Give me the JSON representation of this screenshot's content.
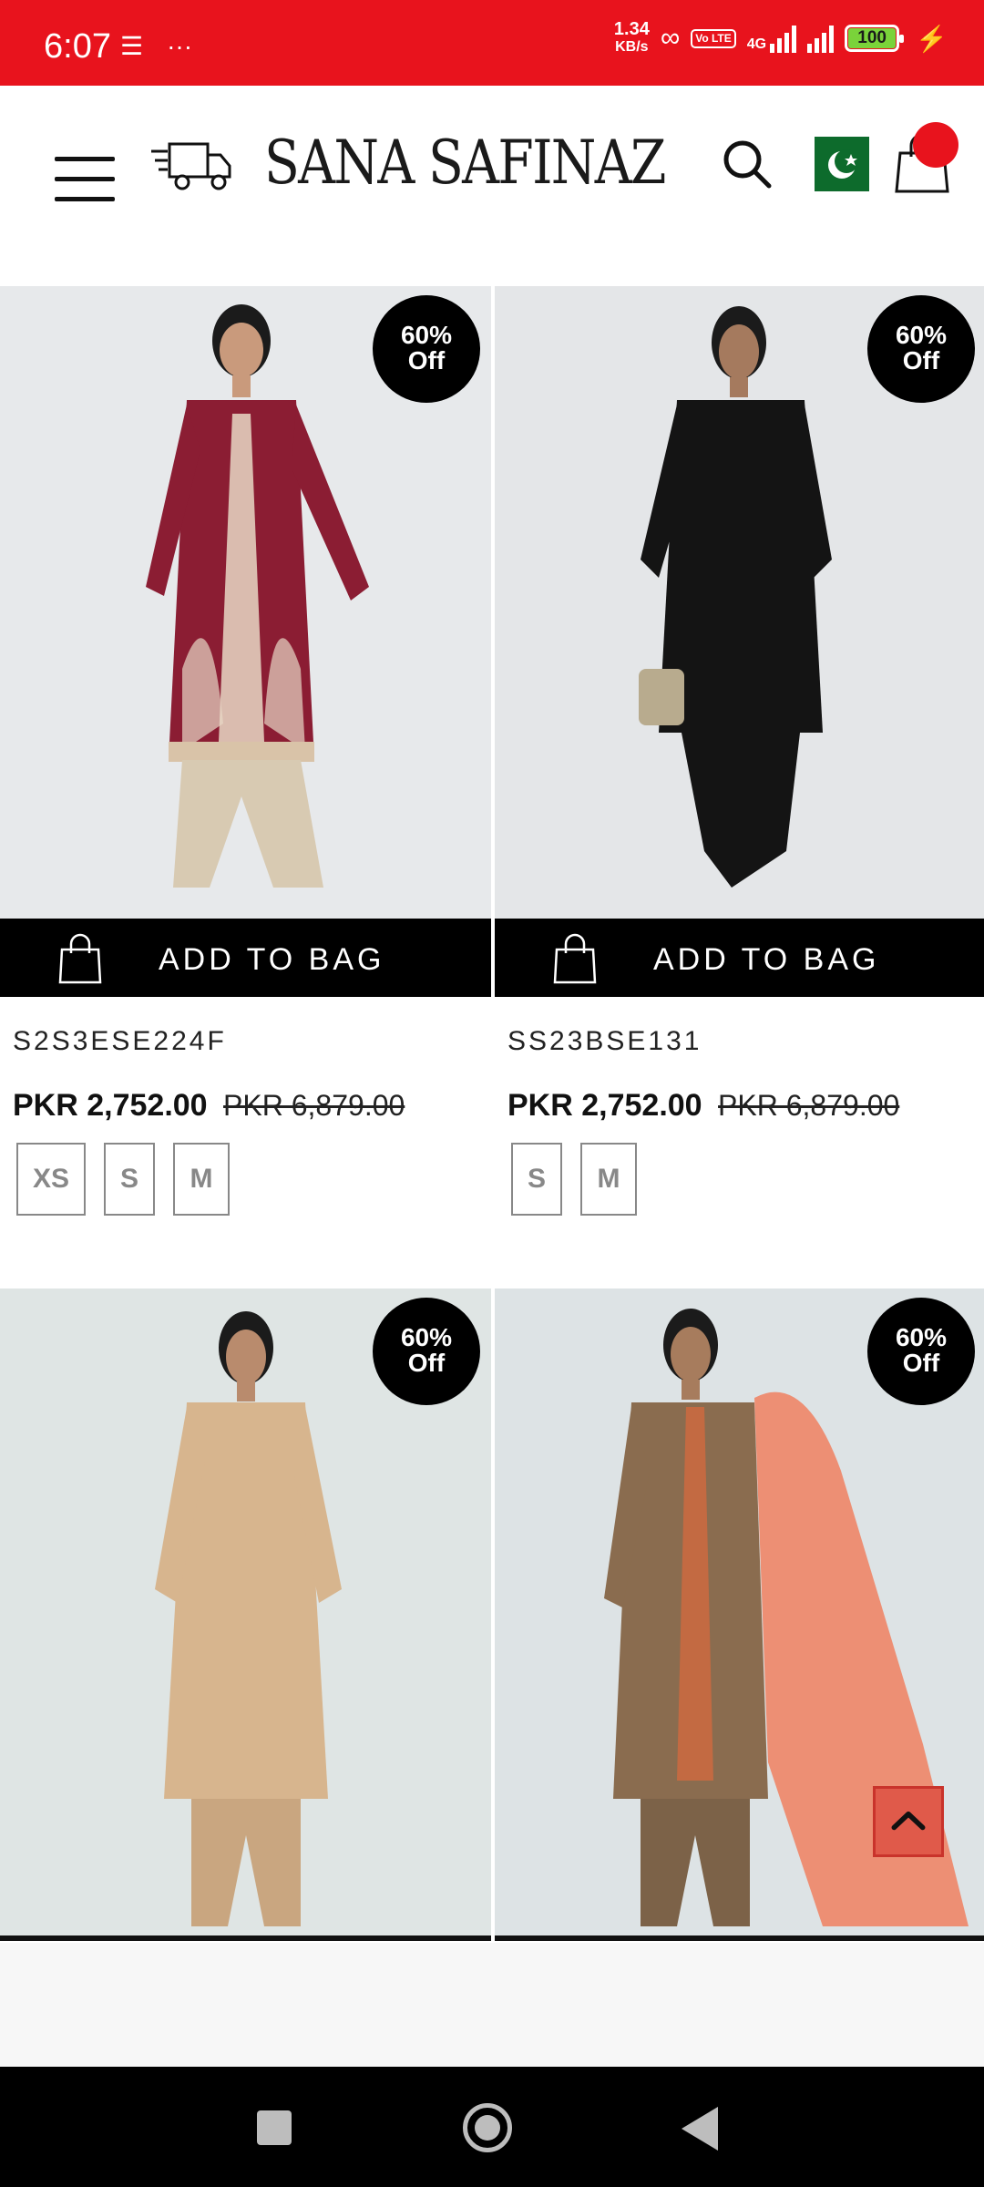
{
  "status": {
    "time": "6:07",
    "speed_value": "1.34",
    "speed_unit": "KB/s",
    "volte": "Vo LTE",
    "network": "4G",
    "battery": "100"
  },
  "header": {
    "brand": "SANA SAFINAZ"
  },
  "products": [
    {
      "discount_line1": "60%",
      "discount_line2": "Off",
      "add_to_bag": "ADD TO BAG",
      "sku": "S2S3ESE224F",
      "price": "PKR 2,752.00",
      "old_price": "PKR 6,879.00",
      "sizes": [
        "XS",
        "S",
        "M"
      ],
      "image_color": "#8b1d33"
    },
    {
      "discount_line1": "60%",
      "discount_line2": "Off",
      "add_to_bag": "ADD TO BAG",
      "sku": "SS23BSE131",
      "price": "PKR 2,752.00",
      "old_price": "PKR 6,879.00",
      "sizes": [
        "S",
        "M"
      ],
      "image_color": "#141414"
    },
    {
      "discount_line1": "60%",
      "discount_line2": "Off",
      "image_color": "#d7b58e"
    },
    {
      "discount_line1": "60%",
      "discount_line2": "Off",
      "image_color": "#8a6c4f"
    }
  ],
  "colors": {
    "status_bar": "#e8131d",
    "accent": "#e8131d",
    "black": "#000000"
  }
}
